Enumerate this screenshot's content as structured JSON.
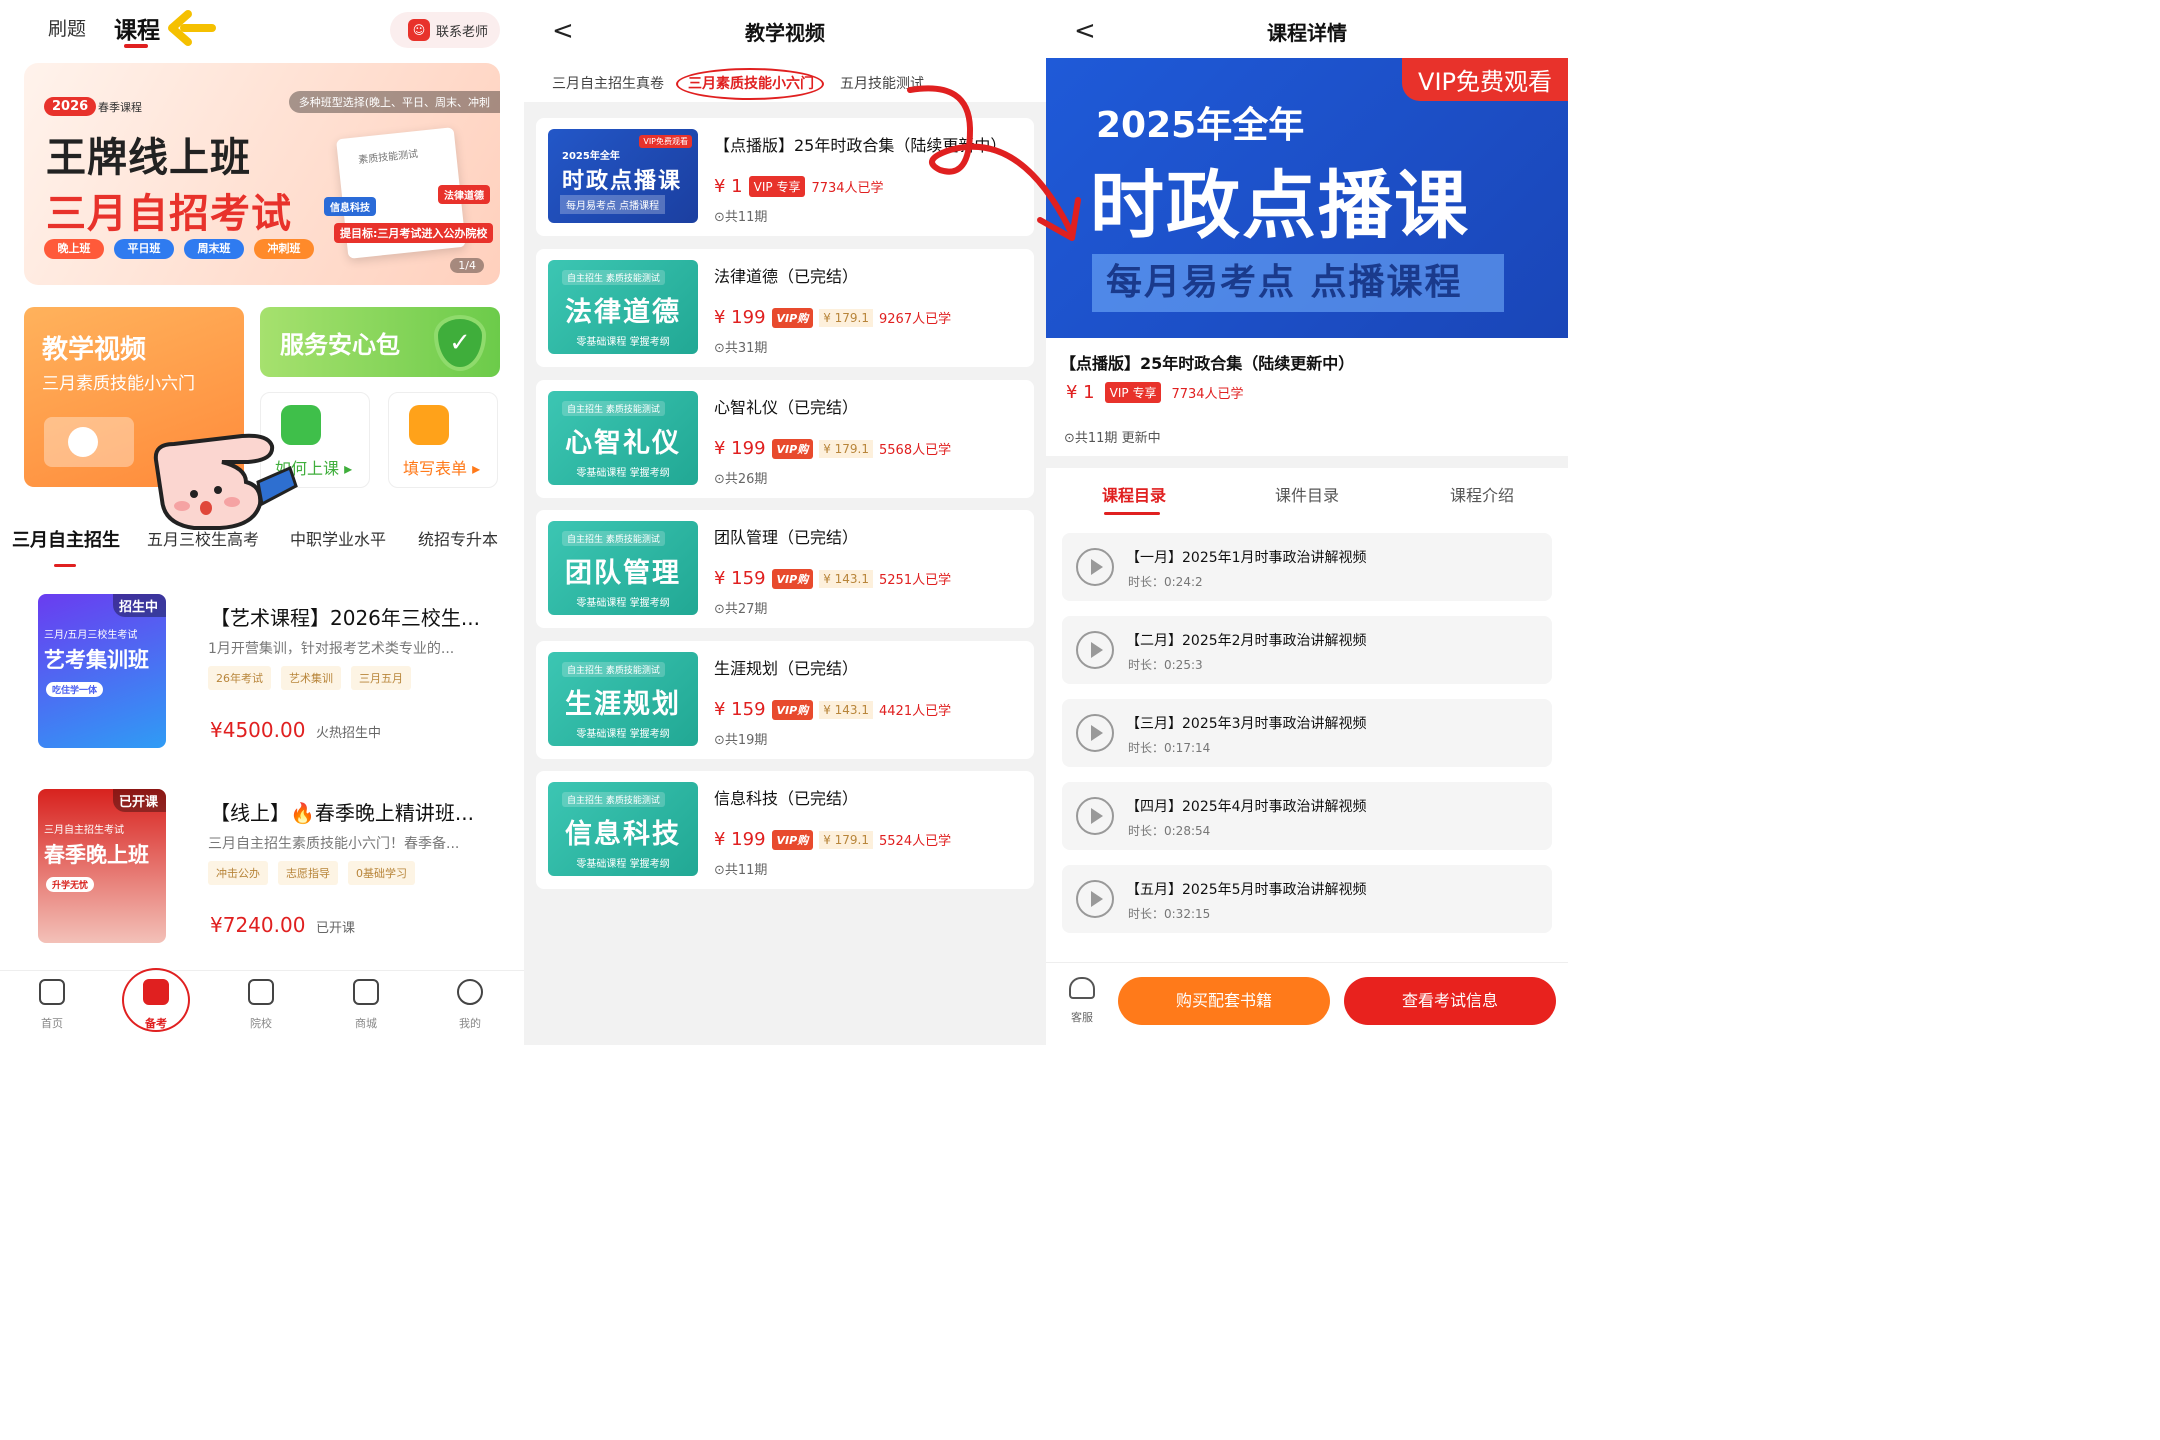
{
  "screen1": {
    "tabs": [
      "刷题",
      "课程"
    ],
    "contact_label": "联系老师",
    "banner": {
      "year": "2026",
      "season": "春季课程",
      "note": "多种班型选择(晚上、平日、周末、冲刺",
      "title1": "王牌线上班",
      "title2": "三月自招考试",
      "book_title": "素质技能测试",
      "pill1": "法律道德",
      "pill2": "信息科技",
      "pill3": "提目标:三月考试进入公办院校",
      "chips": [
        "晚上班",
        "平日班",
        "周末班",
        "冲刺班"
      ],
      "page": "1/4"
    },
    "video_card": {
      "title": "教学视频",
      "subtitle": "三月素质技能小六门"
    },
    "service_card": {
      "title": "服务安心包",
      "check": "✓"
    },
    "small_cards": [
      "如何上课 ▸",
      "填写表单 ▸"
    ],
    "categories": [
      "三月自主招生",
      "五月三校生高考",
      "中职学业水平",
      "统招专升本"
    ],
    "courses": [
      {
        "status": "招生中",
        "thumb_sub": "三月/五月三校生考试",
        "thumb_main": "艺考集训班",
        "thumb_tag": "吃住学一体",
        "title": "【艺术课程】2026年三校生...",
        "desc": "1月开营集训，针对报考艺术类专业的...",
        "tags": [
          "26年考试",
          "艺术集训",
          "三月五月"
        ],
        "price": "¥4500.00",
        "state": "火热招生中"
      },
      {
        "status": "已开课",
        "thumb_sub": "三月自主招生考试",
        "thumb_main": "春季晚上班",
        "thumb_tag": "升学无忧",
        "title": "【线上】🔥春季晚上精讲班...",
        "desc": "三月自主招生素质技能小六门！春季备...",
        "tags": [
          "冲击公办",
          "志愿指导",
          "0基础学习"
        ],
        "price": "¥7240.00",
        "state": "已开课"
      }
    ],
    "tabbar": [
      "首页",
      "备考",
      "院校",
      "商城",
      "我的"
    ]
  },
  "screen2": {
    "back": "<",
    "title": "教学视频",
    "tabs": [
      "三月自主招生真卷",
      "三月素质技能小六门",
      "五月技能测试"
    ],
    "thumb_small": "自主招生 素质技能测试",
    "thumb_foot": "零基础课程 掌握考纲",
    "first_thumb": {
      "vip": "VIP免费观看",
      "year": "2025年全年",
      "main": "时政点播课",
      "foot": "每月易考点 点播课程"
    },
    "items": [
      {
        "title": "【点播版】25年时政合集（陆续更新中）",
        "price": "¥ 1",
        "vip_label": "VIP 专享",
        "learners": "7734人已学",
        "periods": "⊙共11期"
      },
      {
        "thumb": "法律道德",
        "title": "法律道德（已完结）",
        "price": "¥ 199",
        "vip_label": "VIP购",
        "vip_price": "¥ 179.1",
        "learners": "9267人已学",
        "periods": "⊙共31期"
      },
      {
        "thumb": "心智礼仪",
        "title": "心智礼仪（已完结）",
        "price": "¥ 199",
        "vip_label": "VIP购",
        "vip_price": "¥ 179.1",
        "learners": "5568人已学",
        "periods": "⊙共26期"
      },
      {
        "thumb": "团队管理",
        "title": "团队管理（已完结）",
        "price": "¥ 159",
        "vip_label": "VIP购",
        "vip_price": "¥ 143.1",
        "learners": "5251人已学",
        "periods": "⊙共27期"
      },
      {
        "thumb": "生涯规划",
        "title": "生涯规划（已完结）",
        "price": "¥ 159",
        "vip_label": "VIP购",
        "vip_price": "¥ 143.1",
        "learners": "4421人已学",
        "periods": "⊙共19期"
      },
      {
        "thumb": "信息科技",
        "title": "信息科技（已完结）",
        "price": "¥ 199",
        "vip_label": "VIP购",
        "vip_price": "¥ 179.1",
        "learners": "5524人已学",
        "periods": "⊙共11期"
      }
    ]
  },
  "screen3": {
    "back": "<",
    "title": "课程详情",
    "hero": {
      "vip": "VIP免费观看",
      "year": "2025年全年",
      "main": "时政点播课",
      "foot": "每月易考点 点播课程"
    },
    "course_title": "【点播版】25年时政合集（陆续更新中）",
    "price": "¥ 1",
    "vip_label": "VIP 专享",
    "learners": "7734人已学",
    "meta": "⊙共11期   更新中",
    "tabs": [
      "课程目录",
      "课件目录",
      "课程介绍"
    ],
    "lessons": [
      {
        "title": "【一月】2025年1月时事政治讲解视频",
        "duration": "时长：0:24:2"
      },
      {
        "title": "【二月】2025年2月时事政治讲解视频",
        "duration": "时长：0:25:3"
      },
      {
        "title": "【三月】2025年3月时事政治讲解视频",
        "duration": "时长：0:17:14"
      },
      {
        "title": "【四月】2025年4月时事政治讲解视频",
        "duration": "时长：0:28:54"
      },
      {
        "title": "【五月】2025年5月时事政治讲解视频",
        "duration": "时长：0:32:15"
      }
    ],
    "service_label": "客服",
    "buttons": [
      "购买配套书籍",
      "查看考试信息"
    ]
  },
  "colors": {
    "brand_red": "#e02020",
    "orange": "#ff7a1a",
    "teal": "#21a894",
    "blue": "#1f5ad8"
  }
}
